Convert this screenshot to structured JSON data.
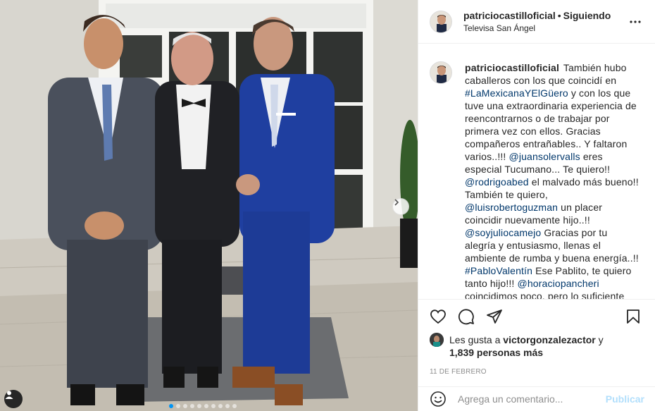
{
  "post": {
    "username": "patriciocastilloficial",
    "follow_status": "Siguiendo",
    "separator": "•",
    "location": "Televisa San Ángel"
  },
  "caption": {
    "username": "patriciocastilloficial",
    "segments": [
      {
        "t": "text",
        "v": "También hubo caballeros con los que coincidí en "
      },
      {
        "t": "link",
        "v": "#LaMexicanaYElGüero"
      },
      {
        "t": "text",
        "v": " y con los que tuve una extraordinaria experiencia de reencontrarnos o de trabajar por primera vez con ellos. Gracias compañeros entrañables.. Y faltaron varios..!!! "
      },
      {
        "t": "link",
        "v": "@juansolervalls"
      },
      {
        "t": "text",
        "v": " eres especial Tucumano... Te quiero!! "
      },
      {
        "t": "link",
        "v": "@rodrigoabed"
      },
      {
        "t": "text",
        "v": " el malvado más bueno!! También te quiero, "
      },
      {
        "t": "link",
        "v": "@luisrobertoguzman"
      },
      {
        "t": "text",
        "v": " un placer coincidir nuevamente hijo..!! "
      },
      {
        "t": "link",
        "v": "@soyjuliocamejo"
      },
      {
        "t": "text",
        "v": " Gracias por tu alegría y entusiasmo, llenas el ambiente de rumba y buena energía..!! "
      },
      {
        "t": "link",
        "v": "#PabloValentín"
      },
      {
        "t": "text",
        "v": " Ese Pablito, te quiero tanto hijo!!! "
      },
      {
        "t": "link",
        "v": "@horaciopancheri"
      },
      {
        "t": "text",
        "v": " coincidimos poco, pero lo suficiente para darme cuenta que eres a todo"
      }
    ]
  },
  "likes": {
    "prefix": "Les gusta a",
    "user": "victorgonzalezactor",
    "connector": "y",
    "count": "1,839 personas más"
  },
  "date": "11 DE FEBRERO",
  "comment_box": {
    "placeholder": "Agrega un comentario...",
    "publish_label": "Publicar"
  },
  "carousel": {
    "total": 10,
    "active": 0
  },
  "colors": {
    "link": "#00376b",
    "publish_disabled": "#b2dffc",
    "carousel_active": "#0095f6",
    "suit_blue": "#1f3fa0",
    "suit_grey": "#4a505c",
    "suit_black": "#202125"
  },
  "icons": [
    "more-options-icon",
    "heart-icon",
    "comment-icon",
    "share-icon",
    "bookmark-icon",
    "emoji-icon",
    "chevron-right-icon",
    "user-tag-icon"
  ]
}
